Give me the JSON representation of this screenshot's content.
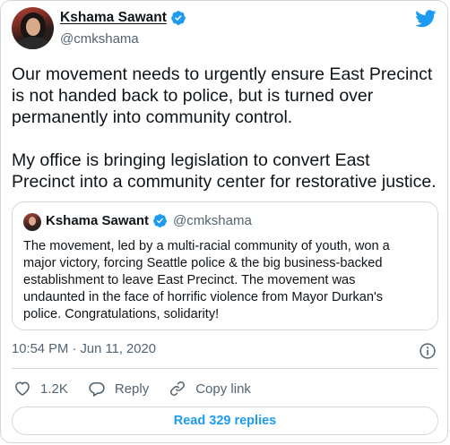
{
  "tweet": {
    "author_name": "Kshama Sawant",
    "author_handle": "@cmkshama",
    "text_lines_p1": [
      "Our movement needs to urgently ensure East Precinct",
      "is not handed back to police, but is turned over",
      "permanently into community control."
    ],
    "text_lines_p2": [
      "My office is bringing legislation to convert East",
      "Precinct into a community center for restorative justice."
    ],
    "timestamp": "10:54 PM · Jun 11, 2020"
  },
  "quoted_tweet": {
    "author_name": "Kshama Sawant",
    "author_handle": "@cmkshama",
    "text_lines": [
      "The movement, led by a multi-racial community of youth, won a",
      "major victory, forcing Seattle police & the big business-backed",
      "establishment to leave East Precinct. The movement was",
      "undaunted in the face of horrific violence from Mayor Durkan's",
      "police. Congratulations, solidarity!"
    ]
  },
  "actions": {
    "like_count": "1.2K",
    "reply_label": "Reply",
    "copy_link_label": "Copy link"
  },
  "read_replies_label": "Read 329 replies",
  "colors": {
    "twitter_blue": "#1d9bf0",
    "text_primary": "#0f1419",
    "text_secondary": "#536471",
    "border": "#cfd9de"
  },
  "icons": [
    "verified-badge-icon",
    "twitter-bird-icon",
    "info-icon",
    "heart-icon",
    "reply-icon",
    "link-icon"
  ]
}
